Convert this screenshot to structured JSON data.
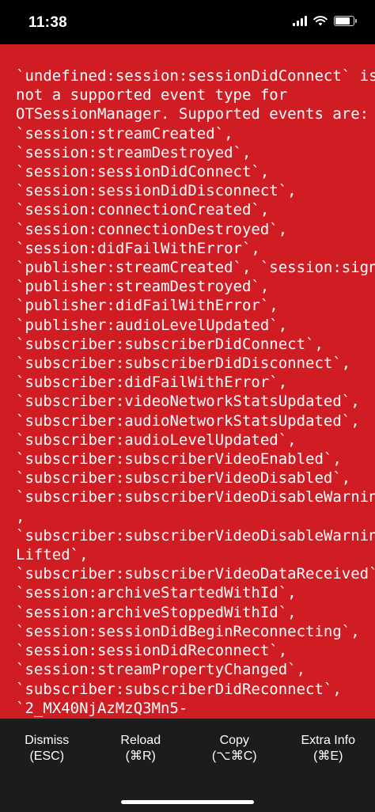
{
  "status_bar": {
    "time": "11:38",
    "icons": [
      "signal-icon",
      "wifi-icon",
      "battery-icon"
    ]
  },
  "error": {
    "background_color": "#D01C23",
    "message": "`undefined:session:sessionDidConnect` is\nnot a supported event type for\nOTSessionManager. Supported events are:\n`session:streamCreated`,\n`session:streamDestroyed`,\n`session:sessionDidConnect`,\n`session:sessionDidDisconnect`,\n`session:connectionCreated`,\n`session:connectionDestroyed`,\n`session:didFailWithError`,\n`publisher:streamCreated`, `session:signal`,\n`publisher:streamDestroyed`,\n`publisher:didFailWithError`,\n`publisher:audioLevelUpdated`,\n`subscriber:subscriberDidConnect`,\n`subscriber:subscriberDidDisconnect`,\n`subscriber:didFailWithError`,\n`subscriber:videoNetworkStatsUpdated`,\n`subscriber:audioNetworkStatsUpdated`,\n`subscriber:audioLevelUpdated`,\n`subscriber:subscriberVideoEnabled`,\n`subscriber:subscriberVideoDisabled`,\n`subscriber:subscriberVideoDisableWarning`\n,\n`subscriber:subscriberVideoDisableWarning\nLifted`,\n`subscriber:subscriberVideoDataReceived`,\n`session:archiveStartedWithId`,\n`session:archiveStoppedWithId`,\n`session:sessionDidBeginReconnecting`,\n`session:sessionDidReconnect`,\n`session:streamPropertyChanged`,\n`subscriber:subscriberDidReconnect`,\n`2_MX40NjAzMzQ3Mn5-"
  },
  "toolbar": {
    "background_color": "#1c1c1c",
    "buttons": [
      {
        "label": "Dismiss",
        "shortcut": "(ESC)"
      },
      {
        "label": "Reload",
        "shortcut": "(⌘R)"
      },
      {
        "label": "Copy",
        "shortcut": "(⌥⌘C)"
      },
      {
        "label": "Extra Info",
        "shortcut": "(⌘E)"
      }
    ]
  }
}
